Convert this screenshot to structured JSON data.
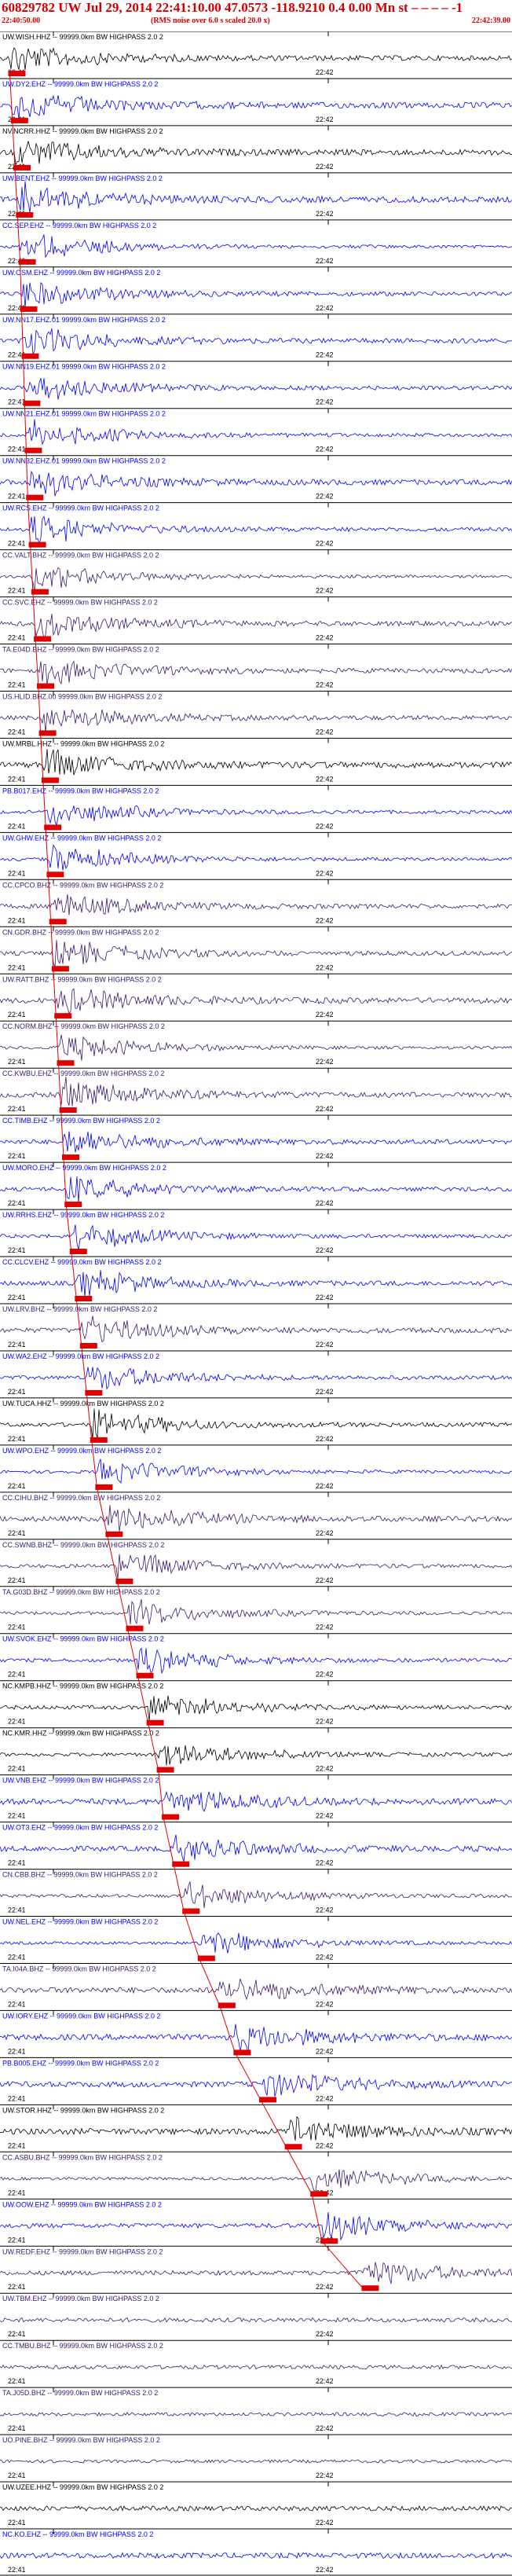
{
  "header": {
    "title": "60829782 UW Jul 29, 2014 22:41:10.00    47.0573  -118.9210  0.4 0.00 Mn st – – – –   -1",
    "start_time": "22:40:50.00",
    "end_time": "22:42:39.00",
    "note": "(RMS noise over 6.0 s scaled 20.0 x)"
  },
  "chart_data": {
    "type": "line",
    "title": "60829782 UW Jul 29, 2014 22:41:10.00    47.0573  -118.9210  0.4 0.00 Mn st – – – –   -1",
    "time_window": [
      "22:40:50.00",
      "22:42:39.00"
    ],
    "tick_labels": [
      "22:41",
      "22:42"
    ],
    "pick_marker_color": "#e00000",
    "channels": [
      {
        "label": "UW.WISH.HHZ -- 99999.0km BW  HIGHPASS  2.0  2",
        "color": "#000000",
        "pick_fraction": 0.01
      },
      {
        "label": "UW.DY2.EHZ -- 99999.0km BW  HIGHPASS  2.0  2",
        "color": "#0000ff",
        "pick_fraction": 0.015
      },
      {
        "label": "NV.NCRR.HHZ -- 99999.0km BW  HIGHPASS  2.0  2",
        "color": "#000000",
        "pick_fraction": 0.02
      },
      {
        "label": "UW.BENT.EHZ -- 99999.0km BW  HIGHPASS  2.0  2",
        "color": "#0000ff",
        "pick_fraction": 0.025
      },
      {
        "label": "CC.SEP.EHZ -- 99999.0km BW  HIGHPASS  2.0  2",
        "color": "#0000ff",
        "pick_fraction": 0.03
      },
      {
        "label": "UW.OSM.EHZ -- 99999.0km BW  HIGHPASS  2.0  2",
        "color": "#0000ff",
        "pick_fraction": 0.033
      },
      {
        "label": "UW.NN17.EHZ.01 99999.0km BW  HIGHPASS  2.0  2",
        "color": "#0000ff",
        "pick_fraction": 0.036
      },
      {
        "label": "UW.NN19.EHZ.01 99999.0km BW  HIGHPASS  2.0  2",
        "color": "#0000ff",
        "pick_fraction": 0.039
      },
      {
        "label": "UW.NN21.EHZ.01 99999.0km BW  HIGHPASS  2.0  2",
        "color": "#0000ff",
        "pick_fraction": 0.042
      },
      {
        "label": "UW.NN32.EHZ.01 99999.0km BW  HIGHPASS  2.0  2",
        "color": "#0000ff",
        "pick_fraction": 0.045
      },
      {
        "label": "UW.RCS.EHZ -- 99999.0km BW  HIGHPASS  2.0  2",
        "color": "#0000ff",
        "pick_fraction": 0.05
      },
      {
        "label": "CC.VALT.BHZ -- 99999.0km BW  HIGHPASS  2.0  2",
        "color": "#3a1a6e",
        "pick_fraction": 0.055
      },
      {
        "label": "CC.SVC.EHZ -- 99999.0km BW  HIGHPASS  2.0  2",
        "color": "#3a1a6e",
        "pick_fraction": 0.06
      },
      {
        "label": "TA.E04D.BHZ -- 99999.0km BW  HIGHPASS  2.0  2",
        "color": "#3a1a6e",
        "pick_fraction": 0.066
      },
      {
        "label": "US.HLID.BHZ.00 99999.0km BW  HIGHPASS  2.0  2",
        "color": "#3a1a6e",
        "pick_fraction": 0.07
      },
      {
        "label": "UW.MRBL.HHZ -- 99999.0km BW  HIGHPASS  2.0  2",
        "color": "#000000",
        "pick_fraction": 0.075
      },
      {
        "label": "PB.B017.EHZ -- 99999.0km BW  HIGHPASS  2.0  2",
        "color": "#0000ff",
        "pick_fraction": 0.08
      },
      {
        "label": "UW.GHW.EHZ -- 99999.0km BW  HIGHPASS  2.0  2",
        "color": "#0000ff",
        "pick_fraction": 0.085
      },
      {
        "label": "CC.CPCO.BHZ -- 99999.0km BW  HIGHPASS  2.0  2",
        "color": "#3a1a6e",
        "pick_fraction": 0.09
      },
      {
        "label": "CN.GDR.BHZ -- 99999.0km BW  HIGHPASS  2.0  2",
        "color": "#3a1a6e",
        "pick_fraction": 0.095
      },
      {
        "label": "UW.RATT.BHZ -- 99999.0km BW  HIGHPASS  2.0  2",
        "color": "#3a1a6e",
        "pick_fraction": 0.1
      },
      {
        "label": "CC.NORM.BHZ -- 99999.0km BW  HIGHPASS  2.0  2",
        "color": "#3a1a6e",
        "pick_fraction": 0.105
      },
      {
        "label": "CC.KWBU.EHZ -- 99999.0km BW  HIGHPASS  2.0  2",
        "color": "#3a1a6e",
        "pick_fraction": 0.11
      },
      {
        "label": "CC.TIMB.EHZ -- 99999.0km BW  HIGHPASS  2.0  2",
        "color": "#0000ff",
        "pick_fraction": 0.115
      },
      {
        "label": "UW.MORO.EHZ -- 99999.0km BW  HIGHPASS  2.0  2",
        "color": "#0000ff",
        "pick_fraction": 0.12
      },
      {
        "label": "UW.RRHS.EHZ -- 99999.0km BW  HIGHPASS  2.0  2",
        "color": "#0000ff",
        "pick_fraction": 0.13
      },
      {
        "label": "CC.CLCV.EHZ -- 99999.0km BW  HIGHPASS  2.0  2",
        "color": "#0000ff",
        "pick_fraction": 0.14
      },
      {
        "label": "UW.LRV.BHZ -- 99999.0km BW  HIGHPASS  2.0  2",
        "color": "#3a1a6e",
        "pick_fraction": 0.15
      },
      {
        "label": "UW.WA2.EHZ -- 99999.0km BW  HIGHPASS  2.0  2",
        "color": "#0000ff",
        "pick_fraction": 0.16
      },
      {
        "label": "UW.TUCA.HHZ -- 99999.0km BW  HIGHPASS  2.0  2",
        "color": "#000000",
        "pick_fraction": 0.17
      },
      {
        "label": "UW.WPO.EHZ -- 99999.0km BW  HIGHPASS  2.0  2",
        "color": "#0000ff",
        "pick_fraction": 0.18
      },
      {
        "label": "CC.CIHU.BHZ -- 99999.0km BW  HIGHPASS  2.0  2",
        "color": "#3a1a6e",
        "pick_fraction": 0.2
      },
      {
        "label": "CC.SWNB.BHZ -- 99999.0km BW  HIGHPASS  2.0  2",
        "color": "#3a1a6e",
        "pick_fraction": 0.22
      },
      {
        "label": "TA.G03D.BHZ -- 99999.0km BW  HIGHPASS  2.0  2",
        "color": "#3a1a6e",
        "pick_fraction": 0.24
      },
      {
        "label": "UW.SVOK.EHZ -- 99999.0km BW  HIGHPASS  2.0  2",
        "color": "#0000ff",
        "pick_fraction": 0.26
      },
      {
        "label": "NC.KMPB.HHZ -- 99999.0km BW  HIGHPASS  2.0  2",
        "color": "#000000",
        "pick_fraction": 0.28
      },
      {
        "label": "NC.KMR.HHZ -- 99999.0km BW  HIGHPASS  2.0  2",
        "color": "#000000",
        "pick_fraction": 0.3
      },
      {
        "label": "UW.VNB.EHZ -- 99999.0km BW  HIGHPASS  2.0  2",
        "color": "#0000ff",
        "pick_fraction": 0.31
      },
      {
        "label": "UW.OT3.EHZ -- 99999.0km BW  HIGHPASS  2.0  2",
        "color": "#0000ff",
        "pick_fraction": 0.33
      },
      {
        "label": "CN.CBB.BHZ -- 99999.0km BW  HIGHPASS  2.0  2",
        "color": "#3a1a6e",
        "pick_fraction": 0.35
      },
      {
        "label": "UW.NEL.EHZ -- 99999.0km BW  HIGHPASS  2.0  2",
        "color": "#0000ff",
        "pick_fraction": 0.38
      },
      {
        "label": "TA.I04A.BHZ -- 99999.0km BW  HIGHPASS  2.0  2",
        "color": "#3a1a6e",
        "pick_fraction": 0.42
      },
      {
        "label": "UW.IORY.EHZ -- 99999.0km BW  HIGHPASS  2.0  2",
        "color": "#0000ff",
        "pick_fraction": 0.45
      },
      {
        "label": "PB.B005.EHZ -- 99999.0km BW  HIGHPASS  2.0  2",
        "color": "#0000ff",
        "pick_fraction": 0.5
      },
      {
        "label": "UW.STOR.HHZ -- 99999.0km BW  HIGHPASS  2.0  2",
        "color": "#000000",
        "pick_fraction": 0.55
      },
      {
        "label": "CC.ASBU.BHZ -- 99999.0km BW  HIGHPASS  2.0  2",
        "color": "#3a1a6e",
        "pick_fraction": 0.6
      },
      {
        "label": "UW.OOW.EHZ -- 99999.0km BW  HIGHPASS  2.0  2",
        "color": "#0000ff",
        "pick_fraction": 0.62
      },
      {
        "label": "UW.REDF.EHZ -- 99999.0km BW  HIGHPASS  2.0  2",
        "color": "#3a1a6e",
        "pick_fraction": 0.7
      },
      {
        "label": "UW.TBM.EHZ -- 99999.0km BW  HIGHPASS  2.0  2",
        "color": "#3a1a6e",
        "pick_fraction": null
      },
      {
        "label": "CC.TMBU.BHZ -- 99999.0km BW  HIGHPASS  2.0  2",
        "color": "#3a1a6e",
        "pick_fraction": null
      },
      {
        "label": "TA.J05D.BHZ -- 99999.0km BW  HIGHPASS  2.0  2",
        "color": "#3a1a6e",
        "pick_fraction": null
      },
      {
        "label": "UO.PINE.BHZ -- 99999.0km BW  HIGHPASS  2.0  2",
        "color": "#3a1a6e",
        "pick_fraction": null
      },
      {
        "label": "UW.UZEE.HHZ -- 99999.0km BW  HIGHPASS  2.0  2",
        "color": "#000000",
        "pick_fraction": null
      },
      {
        "label": "NC.KO.EHZ -- 99999.0km BW  HIGHPASS  2.0  2",
        "color": "#0000ff",
        "pick_fraction": null
      }
    ]
  }
}
